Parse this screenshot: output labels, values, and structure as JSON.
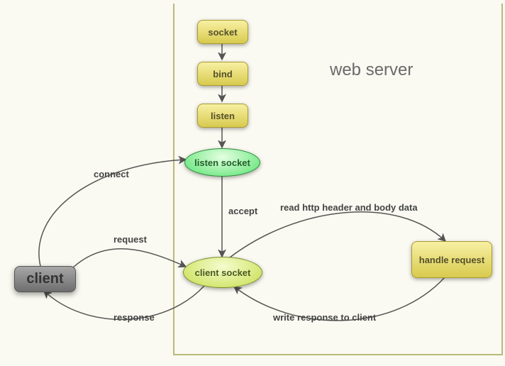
{
  "title": "web server",
  "nodes": {
    "socket": "socket",
    "bind": "bind",
    "listen": "listen",
    "listen_socket": "listen socket",
    "client_socket": "client socket",
    "handle_request": "handle request",
    "client": "client"
  },
  "edges": {
    "connect": "connect",
    "accept": "accept",
    "request": "request",
    "response": "response",
    "read": "read http header and body data",
    "write": "write response to client"
  }
}
